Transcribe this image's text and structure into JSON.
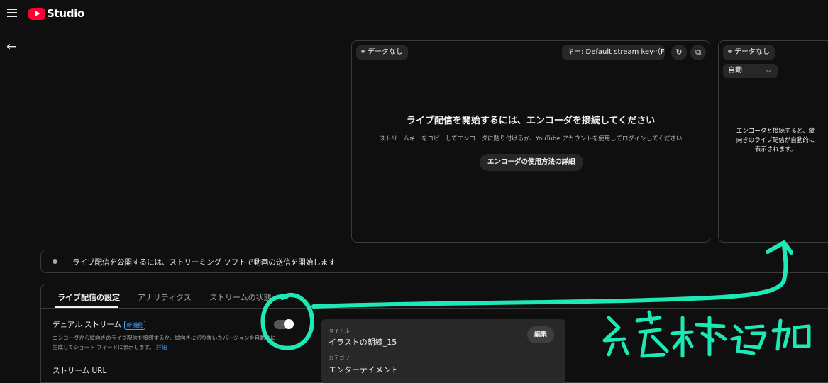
{
  "app": {
    "logo_text": "Studio",
    "brand_color": "#ff0033"
  },
  "stream_panel": {
    "status": "データなし",
    "key_select": "キー: Default stream key（F",
    "title": "ライブ配信を開始するには、エンコーダを接続してください",
    "subtitle": "ストリームキーをコピーしてエンコーダに貼り付けるか、YouTube アカウントを使用してログインしてください",
    "help_button": "エンコーダの使用方法の詳細"
  },
  "vertical_panel": {
    "status": "データなし",
    "mode_select": "自動",
    "message_lines": [
      "エンコーダと接続すると、縦",
      "向きのライブ配信が自動的に",
      "表示されます。"
    ]
  },
  "banner": {
    "text": "ライブ配信を公開するには、ストリーミング ソフトで動画の送信を開始します"
  },
  "tabs": [
    "ライブ配信の設定",
    "アナリティクス",
    "ストリームの状態"
  ],
  "settings": {
    "dual_stream_label": "デュアル ストリーム",
    "new_badge": "新機能",
    "dual_stream_desc_1": "エンコーダから縦向きのライブ配信を接続するか、縦向きに切り抜いたバージョンを自動的に",
    "dual_stream_desc_2": "生成してショート フィードに表示します。",
    "details_link": "詳細",
    "stream_url_label": "ストリーム URL",
    "toggle_state": "on"
  },
  "info_card": {
    "title_label": "タイトル",
    "title_value": "イラストの朝練_15",
    "category_label": "カテゴリ",
    "category_value": "エンターテイメント",
    "edit_button": "編集"
  },
  "annotation": {
    "handwritten_text": "縦枠追加",
    "color": "#1de9b6"
  }
}
